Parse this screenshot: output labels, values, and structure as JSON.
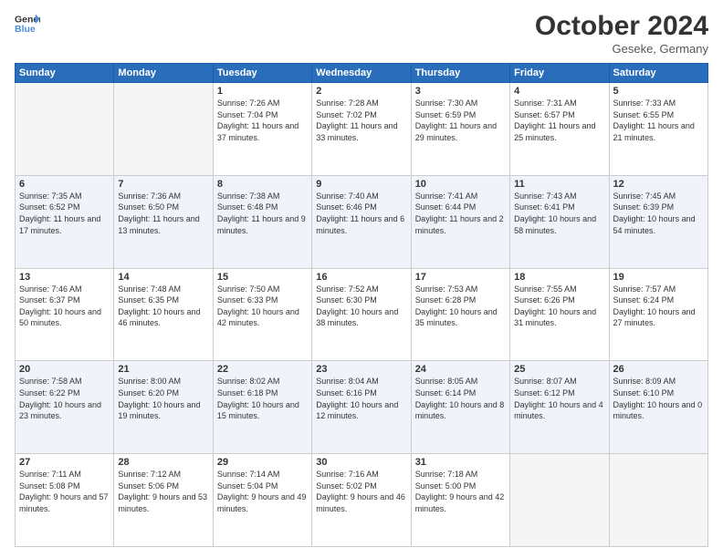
{
  "header": {
    "logo_line1": "General",
    "logo_line2": "Blue",
    "month_year": "October 2024",
    "location": "Geseke, Germany"
  },
  "weekdays": [
    "Sunday",
    "Monday",
    "Tuesday",
    "Wednesday",
    "Thursday",
    "Friday",
    "Saturday"
  ],
  "weeks": [
    [
      {
        "day": "",
        "sunrise": "",
        "sunset": "",
        "daylight": ""
      },
      {
        "day": "",
        "sunrise": "",
        "sunset": "",
        "daylight": ""
      },
      {
        "day": "1",
        "sunrise": "Sunrise: 7:26 AM",
        "sunset": "Sunset: 7:04 PM",
        "daylight": "Daylight: 11 hours and 37 minutes."
      },
      {
        "day": "2",
        "sunrise": "Sunrise: 7:28 AM",
        "sunset": "Sunset: 7:02 PM",
        "daylight": "Daylight: 11 hours and 33 minutes."
      },
      {
        "day": "3",
        "sunrise": "Sunrise: 7:30 AM",
        "sunset": "Sunset: 6:59 PM",
        "daylight": "Daylight: 11 hours and 29 minutes."
      },
      {
        "day": "4",
        "sunrise": "Sunrise: 7:31 AM",
        "sunset": "Sunset: 6:57 PM",
        "daylight": "Daylight: 11 hours and 25 minutes."
      },
      {
        "day": "5",
        "sunrise": "Sunrise: 7:33 AM",
        "sunset": "Sunset: 6:55 PM",
        "daylight": "Daylight: 11 hours and 21 minutes."
      }
    ],
    [
      {
        "day": "6",
        "sunrise": "Sunrise: 7:35 AM",
        "sunset": "Sunset: 6:52 PM",
        "daylight": "Daylight: 11 hours and 17 minutes."
      },
      {
        "day": "7",
        "sunrise": "Sunrise: 7:36 AM",
        "sunset": "Sunset: 6:50 PM",
        "daylight": "Daylight: 11 hours and 13 minutes."
      },
      {
        "day": "8",
        "sunrise": "Sunrise: 7:38 AM",
        "sunset": "Sunset: 6:48 PM",
        "daylight": "Daylight: 11 hours and 9 minutes."
      },
      {
        "day": "9",
        "sunrise": "Sunrise: 7:40 AM",
        "sunset": "Sunset: 6:46 PM",
        "daylight": "Daylight: 11 hours and 6 minutes."
      },
      {
        "day": "10",
        "sunrise": "Sunrise: 7:41 AM",
        "sunset": "Sunset: 6:44 PM",
        "daylight": "Daylight: 11 hours and 2 minutes."
      },
      {
        "day": "11",
        "sunrise": "Sunrise: 7:43 AM",
        "sunset": "Sunset: 6:41 PM",
        "daylight": "Daylight: 10 hours and 58 minutes."
      },
      {
        "day": "12",
        "sunrise": "Sunrise: 7:45 AM",
        "sunset": "Sunset: 6:39 PM",
        "daylight": "Daylight: 10 hours and 54 minutes."
      }
    ],
    [
      {
        "day": "13",
        "sunrise": "Sunrise: 7:46 AM",
        "sunset": "Sunset: 6:37 PM",
        "daylight": "Daylight: 10 hours and 50 minutes."
      },
      {
        "day": "14",
        "sunrise": "Sunrise: 7:48 AM",
        "sunset": "Sunset: 6:35 PM",
        "daylight": "Daylight: 10 hours and 46 minutes."
      },
      {
        "day": "15",
        "sunrise": "Sunrise: 7:50 AM",
        "sunset": "Sunset: 6:33 PM",
        "daylight": "Daylight: 10 hours and 42 minutes."
      },
      {
        "day": "16",
        "sunrise": "Sunrise: 7:52 AM",
        "sunset": "Sunset: 6:30 PM",
        "daylight": "Daylight: 10 hours and 38 minutes."
      },
      {
        "day": "17",
        "sunrise": "Sunrise: 7:53 AM",
        "sunset": "Sunset: 6:28 PM",
        "daylight": "Daylight: 10 hours and 35 minutes."
      },
      {
        "day": "18",
        "sunrise": "Sunrise: 7:55 AM",
        "sunset": "Sunset: 6:26 PM",
        "daylight": "Daylight: 10 hours and 31 minutes."
      },
      {
        "day": "19",
        "sunrise": "Sunrise: 7:57 AM",
        "sunset": "Sunset: 6:24 PM",
        "daylight": "Daylight: 10 hours and 27 minutes."
      }
    ],
    [
      {
        "day": "20",
        "sunrise": "Sunrise: 7:58 AM",
        "sunset": "Sunset: 6:22 PM",
        "daylight": "Daylight: 10 hours and 23 minutes."
      },
      {
        "day": "21",
        "sunrise": "Sunrise: 8:00 AM",
        "sunset": "Sunset: 6:20 PM",
        "daylight": "Daylight: 10 hours and 19 minutes."
      },
      {
        "day": "22",
        "sunrise": "Sunrise: 8:02 AM",
        "sunset": "Sunset: 6:18 PM",
        "daylight": "Daylight: 10 hours and 15 minutes."
      },
      {
        "day": "23",
        "sunrise": "Sunrise: 8:04 AM",
        "sunset": "Sunset: 6:16 PM",
        "daylight": "Daylight: 10 hours and 12 minutes."
      },
      {
        "day": "24",
        "sunrise": "Sunrise: 8:05 AM",
        "sunset": "Sunset: 6:14 PM",
        "daylight": "Daylight: 10 hours and 8 minutes."
      },
      {
        "day": "25",
        "sunrise": "Sunrise: 8:07 AM",
        "sunset": "Sunset: 6:12 PM",
        "daylight": "Daylight: 10 hours and 4 minutes."
      },
      {
        "day": "26",
        "sunrise": "Sunrise: 8:09 AM",
        "sunset": "Sunset: 6:10 PM",
        "daylight": "Daylight: 10 hours and 0 minutes."
      }
    ],
    [
      {
        "day": "27",
        "sunrise": "Sunrise: 7:11 AM",
        "sunset": "Sunset: 5:08 PM",
        "daylight": "Daylight: 9 hours and 57 minutes."
      },
      {
        "day": "28",
        "sunrise": "Sunrise: 7:12 AM",
        "sunset": "Sunset: 5:06 PM",
        "daylight": "Daylight: 9 hours and 53 minutes."
      },
      {
        "day": "29",
        "sunrise": "Sunrise: 7:14 AM",
        "sunset": "Sunset: 5:04 PM",
        "daylight": "Daylight: 9 hours and 49 minutes."
      },
      {
        "day": "30",
        "sunrise": "Sunrise: 7:16 AM",
        "sunset": "Sunset: 5:02 PM",
        "daylight": "Daylight: 9 hours and 46 minutes."
      },
      {
        "day": "31",
        "sunrise": "Sunrise: 7:18 AM",
        "sunset": "Sunset: 5:00 PM",
        "daylight": "Daylight: 9 hours and 42 minutes."
      },
      {
        "day": "",
        "sunrise": "",
        "sunset": "",
        "daylight": ""
      },
      {
        "day": "",
        "sunrise": "",
        "sunset": "",
        "daylight": ""
      }
    ]
  ]
}
